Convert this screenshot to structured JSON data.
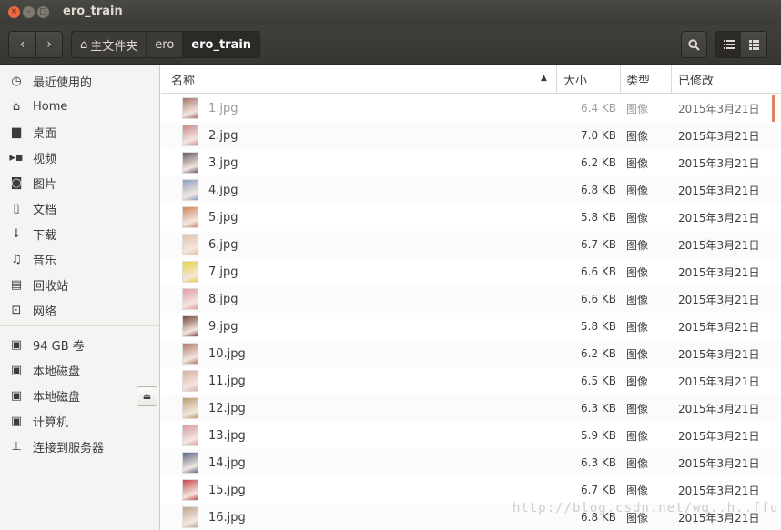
{
  "window": {
    "title": "ero_train",
    "controls": {
      "close": "×",
      "minimize": "–",
      "maximize": "□"
    }
  },
  "toolbar": {
    "back_glyph": "‹",
    "forward_glyph": "›",
    "breadcrumbs": [
      "主文件夹",
      "ero",
      "ero_train"
    ],
    "home_glyph": "⌂",
    "search_glyph": "🔍",
    "list_view_glyph": "☰",
    "grid_view_glyph": "⋮⋮⋮"
  },
  "sidebar": {
    "items": [
      {
        "label": "最近使用的",
        "icon": "clock-icon",
        "glyph": "◷"
      },
      {
        "label": "Home",
        "icon": "home-icon",
        "glyph": "⌂"
      },
      {
        "label": "桌面",
        "icon": "desktop-icon",
        "glyph": "▆"
      },
      {
        "label": "视频",
        "icon": "video-icon",
        "glyph": "▸▪"
      },
      {
        "label": "图片",
        "icon": "camera-icon",
        "glyph": "◙"
      },
      {
        "label": "文档",
        "icon": "document-icon",
        "glyph": "▯"
      },
      {
        "label": "下载",
        "icon": "download-icon",
        "glyph": "↓"
      },
      {
        "label": "音乐",
        "icon": "music-icon",
        "glyph": "♫"
      },
      {
        "label": "回收站",
        "icon": "trash-icon",
        "glyph": "▤"
      },
      {
        "label": "网络",
        "icon": "network-icon",
        "glyph": "⊡"
      }
    ],
    "devices": [
      {
        "label": "94 GB 卷",
        "icon": "drive-icon",
        "glyph": "▣"
      },
      {
        "label": "本地磁盘",
        "icon": "drive-icon",
        "glyph": "▣"
      },
      {
        "label": "本地磁盘",
        "icon": "drive-icon",
        "glyph": "▣",
        "eject_glyph": "⏏"
      },
      {
        "label": "计算机",
        "icon": "computer-icon",
        "glyph": "▣"
      },
      {
        "label": "连接到服务器",
        "icon": "server-icon",
        "glyph": "⊥"
      }
    ]
  },
  "columns": {
    "name": "名称",
    "size": "大小",
    "type": "类型",
    "modified": "已修改",
    "sort_glyph": "▲"
  },
  "files": [
    {
      "name": "1.jpg",
      "size": "6.4 KB",
      "type": "图像",
      "modified": "2015年3月21日",
      "thumb_color": "#a8766a"
    },
    {
      "name": "2.jpg",
      "size": "7.0 KB",
      "type": "图像",
      "modified": "2015年3月21日",
      "thumb_color": "#c98a8e"
    },
    {
      "name": "3.jpg",
      "size": "6.2 KB",
      "type": "图像",
      "modified": "2015年3月21日",
      "thumb_color": "#6e5a6a"
    },
    {
      "name": "4.jpg",
      "size": "6.8 KB",
      "type": "图像",
      "modified": "2015年3月21日",
      "thumb_color": "#8da0c4"
    },
    {
      "name": "5.jpg",
      "size": "5.8 KB",
      "type": "图像",
      "modified": "2015年3月21日",
      "thumb_color": "#d08a5c"
    },
    {
      "name": "6.jpg",
      "size": "6.7 KB",
      "type": "图像",
      "modified": "2015年3月21日",
      "thumb_color": "#e3c0a8"
    },
    {
      "name": "7.jpg",
      "size": "6.6 KB",
      "type": "图像",
      "modified": "2015年3月21日",
      "thumb_color": "#e6d23c"
    },
    {
      "name": "8.jpg",
      "size": "6.6 KB",
      "type": "图像",
      "modified": "2015年3月21日",
      "thumb_color": "#e39aa8"
    },
    {
      "name": "9.jpg",
      "size": "5.8 KB",
      "type": "图像",
      "modified": "2015年3月21日",
      "thumb_color": "#7a4a3c"
    },
    {
      "name": "10.jpg",
      "size": "6.2 KB",
      "type": "图像",
      "modified": "2015年3月21日",
      "thumb_color": "#b07a6e"
    },
    {
      "name": "11.jpg",
      "size": "6.5 KB",
      "type": "图像",
      "modified": "2015年3月21日",
      "thumb_color": "#d6b0a2"
    },
    {
      "name": "12.jpg",
      "size": "6.3 KB",
      "type": "图像",
      "modified": "2015年3月21日",
      "thumb_color": "#b8a072"
    },
    {
      "name": "13.jpg",
      "size": "5.9 KB",
      "type": "图像",
      "modified": "2015年3月21日",
      "thumb_color": "#d89aa6"
    },
    {
      "name": "14.jpg",
      "size": "6.3 KB",
      "type": "图像",
      "modified": "2015年3月21日",
      "thumb_color": "#5c6a8a"
    },
    {
      "name": "15.jpg",
      "size": "6.7 KB",
      "type": "图像",
      "modified": "2015年3月21日",
      "thumb_color": "#c84a4a"
    },
    {
      "name": "16.jpg",
      "size": "6.8 KB",
      "type": "图像",
      "modified": "2015年3月21日",
      "thumb_color": "#c2a890"
    }
  ],
  "watermark": "http://blog.csdn.net/wq..h..ffu",
  "colors": {
    "accent": "#e0835f",
    "titlebar": "#3c3b37",
    "sidebar_bg": "#f5f4f2"
  }
}
